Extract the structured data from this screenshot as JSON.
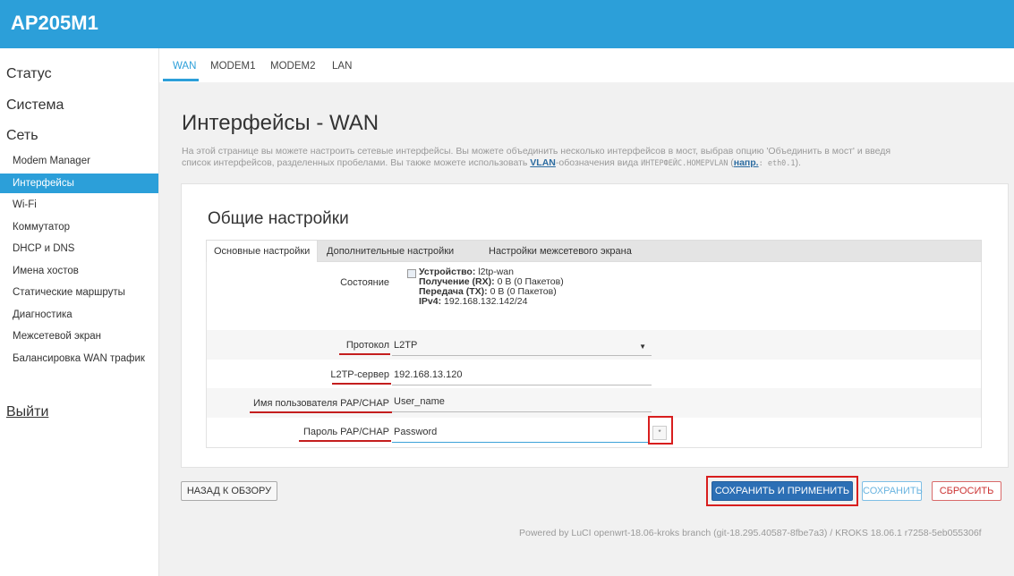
{
  "app": {
    "title": "AP205M1"
  },
  "sidebar": {
    "status": "Статус",
    "system": "Система",
    "network": "Сеть",
    "items": [
      {
        "label": "Modem Manager",
        "active": false
      },
      {
        "label": "Интерфейсы",
        "active": true
      },
      {
        "label": "Wi-Fi",
        "active": false
      },
      {
        "label": "Коммутатор",
        "active": false
      },
      {
        "label": "DHCP и DNS",
        "active": false
      },
      {
        "label": "Имена хостов",
        "active": false
      },
      {
        "label": "Статические маршруты",
        "active": false
      },
      {
        "label": "Диагностика",
        "active": false
      },
      {
        "label": "Межсетевой экран",
        "active": false
      },
      {
        "label": "Балансировка WAN трафик",
        "active": false
      }
    ],
    "logout": "Выйти"
  },
  "topnav": {
    "tabs": [
      "WAN",
      "MODEM1",
      "MODEM2",
      "LAN"
    ],
    "active": "WAN"
  },
  "page": {
    "title": "Интерфейсы - WAN",
    "desc_part1": "На этой странице вы можете настроить сетевые интерфейсы. Вы можете объединить несколько интерфейсов в мост, выбрав опцию 'Объединить в мост' и введя",
    "desc_part2": "список интерфейсов, разделенных пробелами. Вы также можете использовать ",
    "desc_link": "VLAN",
    "desc_part3": "-обозначения вида ",
    "desc_code": "ИНТЕРФЕЙС.НОМЕРVLAN",
    "desc_part4": " (",
    "desc_example_link": "напр.",
    "desc_example_code": ": eth0.1",
    "desc_part5": ")."
  },
  "panel": {
    "title": "Общие настройки",
    "tabs": [
      "Основные настройки",
      "Дополнительные настройки",
      "Настройки межсетевого экрана"
    ]
  },
  "status": {
    "label": "Состояние",
    "device_label": "Устройство:",
    "device_value": "l2tp-wan",
    "rx_label": "Получение (RX):",
    "rx_value": "0 B (0 Пакетов)",
    "tx_label": "Передача (TX):",
    "tx_value": "0 B (0 Пакетов)",
    "ipv4_label": "IPv4:",
    "ipv4_value": "192.168.132.142/24"
  },
  "form": {
    "protocol_label": "Протокол",
    "protocol_value": "L2TP",
    "server_label": "L2TP-сервер",
    "server_value": "192.168.13.120",
    "username_label": "Имя пользователя PAP/CHAP",
    "username_value": "User_name",
    "password_label": "Пароль PAP/CHAP",
    "password_value": "Password",
    "reveal_glyph": "*"
  },
  "buttons": {
    "back": "НАЗАД К ОБЗОРУ",
    "save_apply": "СОХРАНИТЬ И ПРИМЕНИТЬ",
    "save": "СОХРАНИТЬ",
    "reset": "СБРОСИТЬ"
  },
  "footer": {
    "text": "Powered by LuCI openwrt-18.06-kroks branch (git-18.295.40587-8fbe7a3) / KROKS 18.06.1 r7258-5eb055306f"
  },
  "colors": {
    "header": "#2c9fd9",
    "accent": "#2c9fd9",
    "highlight": "#d81e1e",
    "primary_button": "#2c6fb5"
  },
  "icons": {
    "device": "network-device-icon",
    "select": "chevron-down-icon"
  }
}
